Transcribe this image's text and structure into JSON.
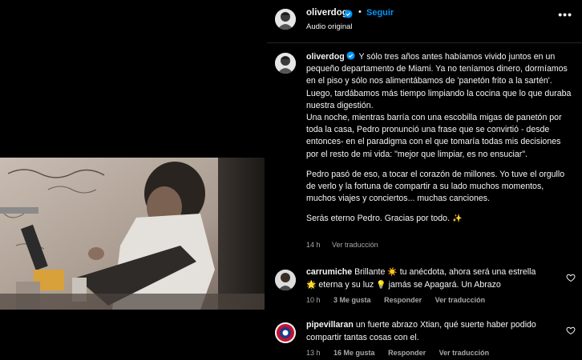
{
  "post": {
    "username": "oliverdog",
    "separator": "•",
    "follow_label": "Seguir",
    "audio_label": "Audio original",
    "more_label": "•••"
  },
  "caption": {
    "username": "oliverdog",
    "paragraph1": "Y sólo tres años antes habíamos vivido juntos en un pequeño departamento de Miami. Ya no teníamos dinero, dormíamos en el piso y sólo nos alimentábamos de 'panetón frito a la sartén'. Luego, tardábamos más tiempo limpiando la cocina que lo que duraba nuestra digestión.",
    "paragraph2": "Una noche, mientras barría con una escobilla migas de panetón por toda la casa, Pedro pronunció una frase que se convirtió - desde entonces- en el paradigma con el que tomaría todas mis decisiones por el resto de mi vida: \"mejor que limpiar, es no ensuciar\".",
    "paragraph3": "Pedro pasó de eso, a tocar el corazón de millones. Yo tuve el orgullo de verlo y la fortuna de compartir a su lado muchos momentos, muchos viajes y conciertos... muchas canciones.",
    "paragraph4": "Serás eterno Pedro. Gracias por todo.",
    "paragraph4_emoji": "✨",
    "time": "14 h",
    "translate_label": "Ver traducción"
  },
  "comments": [
    {
      "username": "carrumiche",
      "text_a": "Brillante",
      "emoji_a": "☀️",
      "text_b": "tu anécdota, ahora será una estrella",
      "emoji_b": "🌟",
      "text_c": "eterna y su luz",
      "emoji_c": "💡",
      "text_d": "jamás se Apagará. Un Abrazo",
      "time": "10 h",
      "likes": "3 Me gusta",
      "reply_label": "Responder",
      "translate_label": "Ver traducción"
    },
    {
      "username": "pipevillaran",
      "text": "un fuerte abrazo Xtian, qué suerte haber podido compartir tantas cosas con el.",
      "time": "13 h",
      "likes": "16 Me gusta",
      "reply_label": "Responder",
      "translate_label": "Ver traducción"
    }
  ],
  "colors": {
    "background": "#000000",
    "text": "#f5f5f5",
    "secondary_text": "#a8a8a8",
    "link_blue": "#0095f6",
    "verified_blue": "#0095f6",
    "divider": "#262626"
  },
  "icons": {
    "verified": "verified-badge-icon",
    "more": "more-options-icon",
    "like": "heart-outline-icon"
  }
}
